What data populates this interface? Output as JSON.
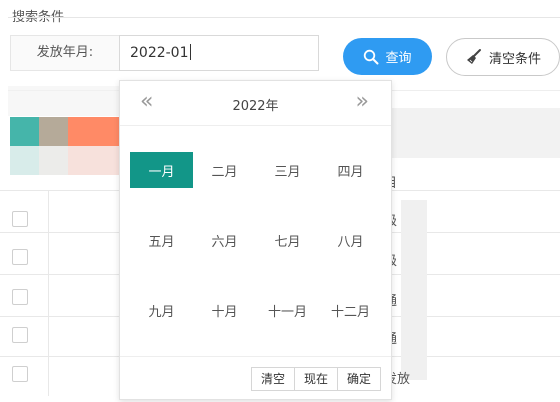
{
  "fieldset": {
    "legend": "搜索条件"
  },
  "form": {
    "label": "发放年月:",
    "input_value": "2022-01"
  },
  "buttons": {
    "query": "查询",
    "clear": "清空条件"
  },
  "icons": {
    "query": "search-icon",
    "clear": "broom-icon"
  },
  "colors": {
    "accent_blue": "#2f9bf2",
    "selected_teal": "#129688",
    "blur_swatches": [
      "#45b5aa",
      "#b5aa99",
      "#ff8a66",
      "#ff8a66"
    ]
  },
  "picker": {
    "prev": "«",
    "next": "»",
    "year": "2022年",
    "months": [
      "一月",
      "二月",
      "三月",
      "四月",
      "五月",
      "六月",
      "七月",
      "八月",
      "九月",
      "十月",
      "十一月",
      "十二月"
    ],
    "selected_month": "一月",
    "footer": {
      "clear": "清空",
      "now": "现在",
      "confirm": "确定"
    }
  },
  "table_bg": {
    "header_fragment": "目",
    "rows": [
      "级",
      "级",
      "通",
      "通",
      "发放"
    ]
  }
}
